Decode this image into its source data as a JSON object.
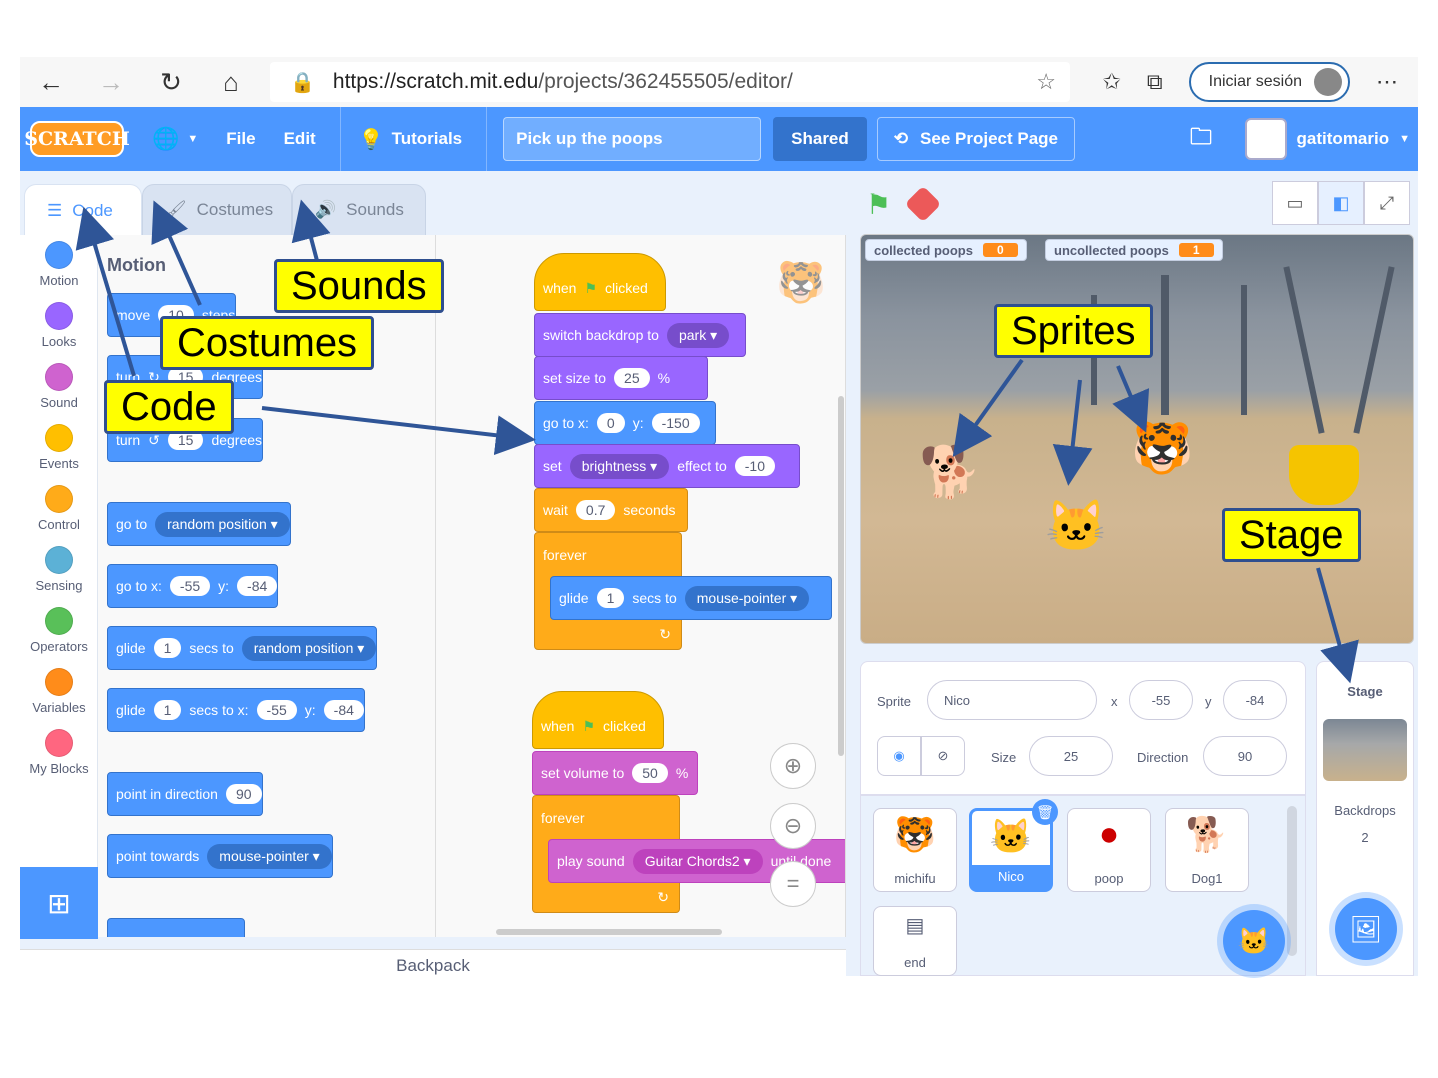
{
  "browser": {
    "url_host": "https://scratch.mit.edu",
    "url_path": "/projects/362455505/editor/",
    "signin_label": "Iniciar sesión"
  },
  "menu": {
    "logo": "SCRATCH",
    "file": "File",
    "edit": "Edit",
    "tutorials": "Tutorials",
    "project_title": "Pick up the poops",
    "shared": "Shared",
    "see_project": "See Project Page",
    "username": "gatitomario"
  },
  "tabs": {
    "code": "Code",
    "costumes": "Costumes",
    "sounds": "Sounds"
  },
  "categories": [
    {
      "label": "Motion",
      "color": "#4c97ff"
    },
    {
      "label": "Looks",
      "color": "#9966ff"
    },
    {
      "label": "Sound",
      "color": "#cf63cf"
    },
    {
      "label": "Events",
      "color": "#ffbf00"
    },
    {
      "label": "Control",
      "color": "#ffab19"
    },
    {
      "label": "Sensing",
      "color": "#5cb1d6"
    },
    {
      "label": "Operators",
      "color": "#59c059"
    },
    {
      "label": "Variables",
      "color": "#ff8c1a"
    },
    {
      "label": "My Blocks",
      "color": "#ff6680"
    }
  ],
  "palette": {
    "title": "Motion",
    "move_label": "move",
    "move_val": "10",
    "move_tail": "steps",
    "turn_label": "turn",
    "turn_val": "15",
    "turn_unit": "degrees",
    "turn2_label": "turn",
    "turn2_val": "15",
    "turn2_unit": "degrees",
    "goto_label": "go to",
    "goto_dd": "random position",
    "gotoxy_label": "go to x:",
    "gotoxy_x": "-55",
    "gotoxy_y_label": "y:",
    "gotoxy_y": "-84",
    "glide1_label": "glide",
    "glide1_val": "1",
    "glide1_mid": "secs to",
    "glide1_dd": "random position",
    "glide2_label": "glide",
    "glide2_val": "1",
    "glide2_mid": "secs to x:",
    "glide2_x": "-55",
    "glide2_y_label": "y:",
    "glide2_y": "-84",
    "point_dir_label": "point in direction",
    "point_dir_val": "90",
    "point_towards_label": "point towards",
    "point_towards_dd": "mouse-pointer"
  },
  "script1": {
    "when": "when",
    "clicked": "clicked",
    "backdrop_label": "switch backdrop to",
    "backdrop_dd": "park",
    "size_label": "set size to",
    "size_val": "25",
    "size_unit": "%",
    "gotox_label": "go to x:",
    "gotox_val": "0",
    "gotoy_label": "y:",
    "gotoy_val": "-150",
    "set_label": "set",
    "effect_dd": "brightness",
    "effect_to": "effect to",
    "effect_val": "-10",
    "wait_label": "wait",
    "wait_val": "0.7",
    "wait_unit": "seconds",
    "forever": "forever",
    "glide_label": "glide",
    "glide_val": "1",
    "glide_mid": "secs to",
    "glide_dd": "mouse-pointer"
  },
  "script2": {
    "when": "when",
    "clicked": "clicked",
    "volume_label": "set volume to",
    "volume_val": "50",
    "volume_unit": "%",
    "forever": "forever",
    "play_label": "play sound",
    "play_dd": "Guitar Chords2",
    "play_tail": "until done"
  },
  "backpack": "Backpack",
  "stage": {
    "monitor1_label": "collected poops",
    "monitor1_val": "0",
    "monitor2_label": "uncollected poops",
    "monitor2_val": "1"
  },
  "sprite_info": {
    "sprite_label": "Sprite",
    "sprite_name": "Nico",
    "x_label": "x",
    "x_val": "-55",
    "y_label": "y",
    "y_val": "-84",
    "size_label": "Size",
    "size_val": "25",
    "direction_label": "Direction",
    "direction_val": "90"
  },
  "sprites": [
    {
      "name": "michifu"
    },
    {
      "name": "Nico"
    },
    {
      "name": "poop"
    },
    {
      "name": "Dog1"
    },
    {
      "name": "end"
    }
  ],
  "stage_panel": {
    "title": "Stage",
    "backdrops_label": "Backdrops",
    "backdrops_count": "2"
  },
  "callouts": {
    "sounds": "Sounds",
    "costumes": "Costumes",
    "code": "Code",
    "sprites": "Sprites",
    "stage": "Stage"
  },
  "colors": {
    "scratch_blue": "#4c97ff",
    "callout_yellow": "#ffff00",
    "arrow_blue": "#2f5597"
  }
}
